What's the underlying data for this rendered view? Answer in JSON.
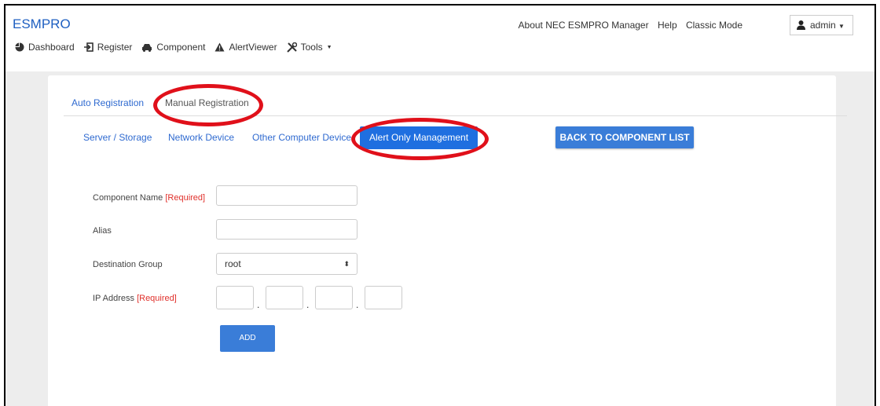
{
  "app": {
    "title": "ESMPRO"
  },
  "header": {
    "links": [
      "About NEC ESMPRO Manager",
      "Help",
      "Classic Mode"
    ],
    "user": "admin"
  },
  "nav": {
    "items": [
      {
        "label": "Dashboard",
        "icon": "pie-chart-icon"
      },
      {
        "label": "Register",
        "icon": "register-icon"
      },
      {
        "label": "Component",
        "icon": "car-icon"
      },
      {
        "label": "AlertViewer",
        "icon": "warning-icon"
      },
      {
        "label": "Tools",
        "icon": "tools-icon",
        "dropdown": true
      }
    ]
  },
  "tabs": {
    "auto": "Auto Registration",
    "manual": "Manual Registration"
  },
  "subtabs": {
    "server": "Server / Storage",
    "network": "Network Device",
    "other": "Other Computer Device",
    "alert": "Alert Only Management"
  },
  "back_button": "BACK TO COMPONENT LIST",
  "form": {
    "component_name": {
      "label": "Component Name",
      "required": "[Required]",
      "value": ""
    },
    "alias": {
      "label": "Alias",
      "value": ""
    },
    "destination_group": {
      "label": "Destination Group",
      "value": "root"
    },
    "ip_address": {
      "label": "IP Address",
      "required": "[Required]",
      "separator": "."
    },
    "add_button": "ADD"
  },
  "colors": {
    "brand": "#1e5fc1",
    "link": "#2f6ad0",
    "active_subtab": "#1f6fe0",
    "button": "#3a7dd8",
    "required": "#e0302b",
    "annotation": "#e0101a"
  }
}
